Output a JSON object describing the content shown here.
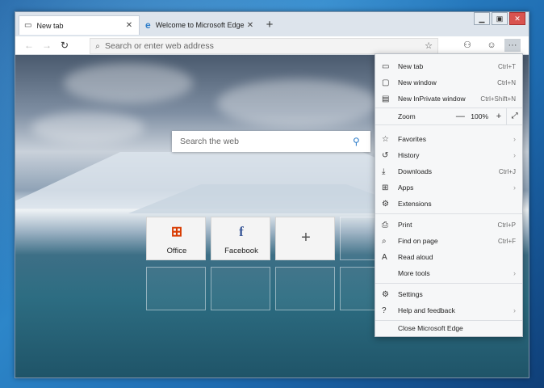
{
  "tabs": [
    {
      "label": "New tab",
      "icon": "new-tab-icon"
    },
    {
      "label": "Welcome to Microsoft Edge Can",
      "icon": "edge-logo-icon"
    }
  ],
  "address": {
    "placeholder": "Search or enter web address"
  },
  "search": {
    "placeholder": "Search the web"
  },
  "tiles": [
    {
      "label": "Office",
      "glyph": "⊞"
    },
    {
      "label": "Facebook",
      "glyph": "f"
    },
    {
      "label": "",
      "glyph": "+"
    }
  ],
  "menu": {
    "items": [
      {
        "label": "New tab",
        "shortcut": "Ctrl+T"
      },
      {
        "label": "New window",
        "shortcut": "Ctrl+N"
      },
      {
        "label": "New InPrivate window",
        "shortcut": "Ctrl+Shift+N"
      }
    ],
    "zoom": {
      "label": "Zoom",
      "minus": "—",
      "value": "100%",
      "plus": "+",
      "fullscreen": "⤢"
    },
    "items2": [
      {
        "label": "Favorites",
        "shortcut": "",
        "arrow": "›"
      },
      {
        "label": "History",
        "shortcut": "",
        "arrow": "›"
      },
      {
        "label": "Downloads",
        "shortcut": "Ctrl+J",
        "arrow": ""
      },
      {
        "label": "Apps",
        "shortcut": "",
        "arrow": "›"
      },
      {
        "label": "Extensions",
        "shortcut": "",
        "arrow": ""
      }
    ],
    "items3": [
      {
        "label": "Print",
        "shortcut": "Ctrl+P",
        "arrow": ""
      },
      {
        "label": "Find on page",
        "shortcut": "Ctrl+F",
        "arrow": ""
      },
      {
        "label": "Read aloud",
        "shortcut": "",
        "arrow": ""
      },
      {
        "label": "More tools",
        "shortcut": "",
        "arrow": "›"
      }
    ],
    "items4": [
      {
        "label": "Settings",
        "shortcut": "",
        "arrow": ""
      },
      {
        "label": "Help and feedback",
        "shortcut": "",
        "arrow": "›"
      }
    ],
    "close": {
      "label": "Close Microsoft Edge"
    }
  },
  "colors": {
    "edge_blue": "#2e7dc9",
    "office_red": "#d83b01",
    "facebook_blue": "#3b5998"
  }
}
